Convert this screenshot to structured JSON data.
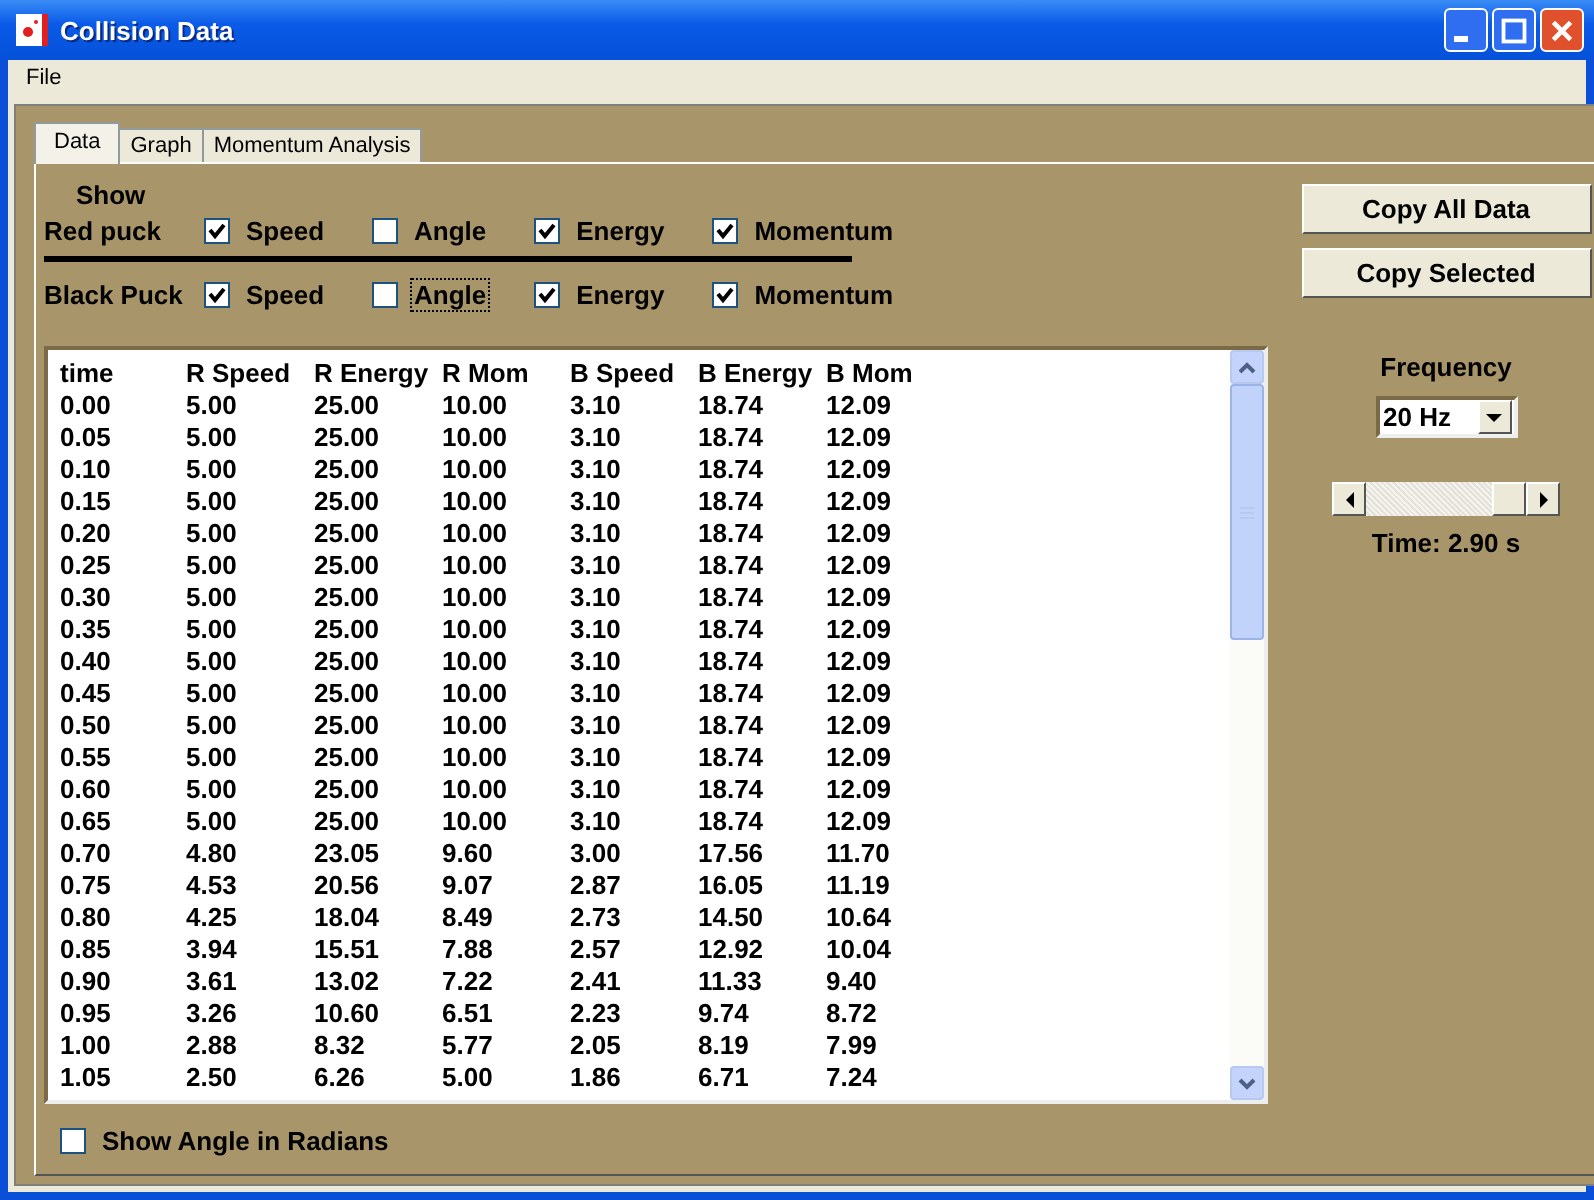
{
  "window": {
    "title": "Collision Data"
  },
  "menu": [
    "File"
  ],
  "tabs": [
    {
      "label": "Data",
      "selected": true
    },
    {
      "label": "Graph",
      "selected": false
    },
    {
      "label": "Momentum Analysis",
      "selected": false
    }
  ],
  "show_label": "Show",
  "puck_rows": [
    {
      "label": "Red puck",
      "options": [
        {
          "label": "Speed",
          "checked": true,
          "focused": false
        },
        {
          "label": "Angle",
          "checked": false,
          "focused": false
        },
        {
          "label": "Energy",
          "checked": true,
          "focused": false
        },
        {
          "label": "Momentum",
          "checked": true,
          "focused": false
        }
      ]
    },
    {
      "label": "Black Puck",
      "options": [
        {
          "label": "Speed",
          "checked": true,
          "focused": false
        },
        {
          "label": "Angle",
          "checked": false,
          "focused": true
        },
        {
          "label": "Energy",
          "checked": true,
          "focused": false
        },
        {
          "label": "Momentum",
          "checked": true,
          "focused": false
        }
      ]
    }
  ],
  "buttons": [
    "Copy All Data",
    "Copy Selected"
  ],
  "table": {
    "columns": [
      "time",
      "R Speed",
      "R Energy",
      "R Mom",
      "B Speed",
      "B Energy",
      "B Mom"
    ],
    "rows": [
      [
        "0.00",
        "5.00",
        "25.00",
        "10.00",
        "3.10",
        "18.74",
        "12.09"
      ],
      [
        "0.05",
        "5.00",
        "25.00",
        "10.00",
        "3.10",
        "18.74",
        "12.09"
      ],
      [
        "0.10",
        "5.00",
        "25.00",
        "10.00",
        "3.10",
        "18.74",
        "12.09"
      ],
      [
        "0.15",
        "5.00",
        "25.00",
        "10.00",
        "3.10",
        "18.74",
        "12.09"
      ],
      [
        "0.20",
        "5.00",
        "25.00",
        "10.00",
        "3.10",
        "18.74",
        "12.09"
      ],
      [
        "0.25",
        "5.00",
        "25.00",
        "10.00",
        "3.10",
        "18.74",
        "12.09"
      ],
      [
        "0.30",
        "5.00",
        "25.00",
        "10.00",
        "3.10",
        "18.74",
        "12.09"
      ],
      [
        "0.35",
        "5.00",
        "25.00",
        "10.00",
        "3.10",
        "18.74",
        "12.09"
      ],
      [
        "0.40",
        "5.00",
        "25.00",
        "10.00",
        "3.10",
        "18.74",
        "12.09"
      ],
      [
        "0.45",
        "5.00",
        "25.00",
        "10.00",
        "3.10",
        "18.74",
        "12.09"
      ],
      [
        "0.50",
        "5.00",
        "25.00",
        "10.00",
        "3.10",
        "18.74",
        "12.09"
      ],
      [
        "0.55",
        "5.00",
        "25.00",
        "10.00",
        "3.10",
        "18.74",
        "12.09"
      ],
      [
        "0.60",
        "5.00",
        "25.00",
        "10.00",
        "3.10",
        "18.74",
        "12.09"
      ],
      [
        "0.65",
        "5.00",
        "25.00",
        "10.00",
        "3.10",
        "18.74",
        "12.09"
      ],
      [
        "0.70",
        "4.80",
        "23.05",
        "9.60",
        "3.00",
        "17.56",
        "11.70"
      ],
      [
        "0.75",
        "4.53",
        "20.56",
        "9.07",
        "2.87",
        "16.05",
        "11.19"
      ],
      [
        "0.80",
        "4.25",
        "18.04",
        "8.49",
        "2.73",
        "14.50",
        "10.64"
      ],
      [
        "0.85",
        "3.94",
        "15.51",
        "7.88",
        "2.57",
        "12.92",
        "10.04"
      ],
      [
        "0.90",
        "3.61",
        "13.02",
        "7.22",
        "2.41",
        "11.33",
        "9.40"
      ],
      [
        "0.95",
        "3.26",
        "10.60",
        "6.51",
        "2.23",
        "9.74",
        "8.72"
      ],
      [
        "1.00",
        "2.88",
        "8.32",
        "5.77",
        "2.05",
        "8.19",
        "7.99"
      ],
      [
        "1.05",
        "2.50",
        "6.26",
        "5.00",
        "1.86",
        "6.71",
        "7.24"
      ]
    ]
  },
  "frequency": {
    "label": "Frequency",
    "value": "20 Hz"
  },
  "time_slider": {
    "level": 1
  },
  "time_label": "Time: 2.90 s",
  "radians_option": {
    "label": "Show Angle in Radians",
    "checked": false
  }
}
